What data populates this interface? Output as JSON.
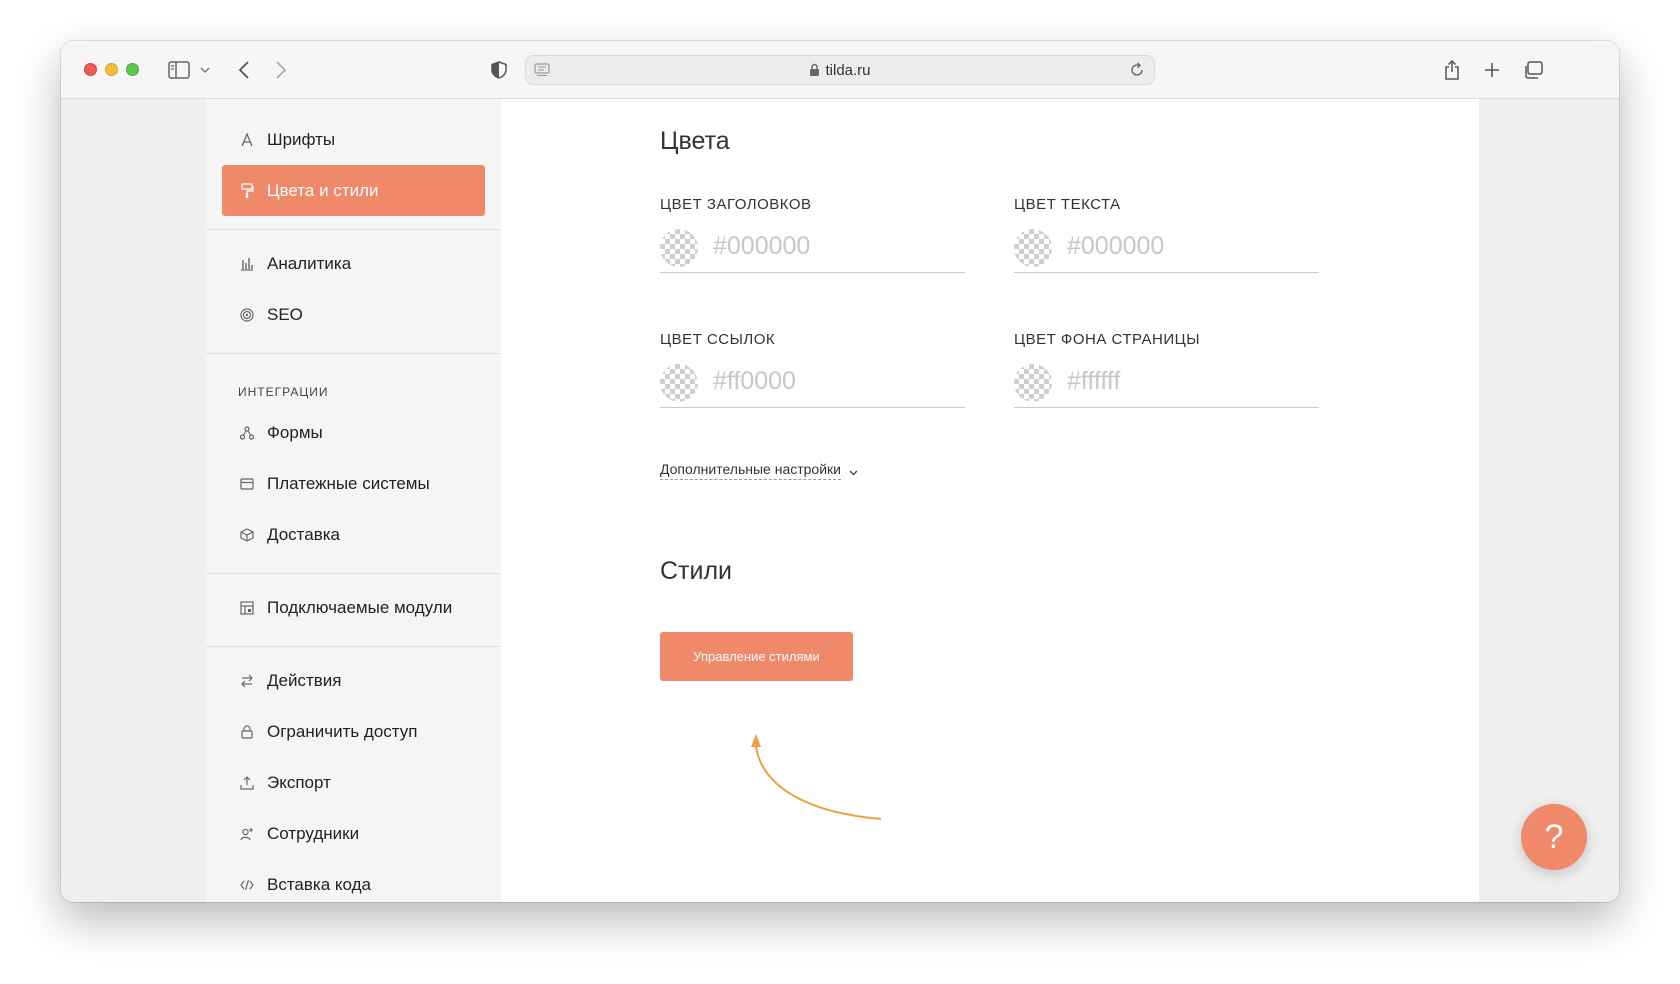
{
  "browser": {
    "url": "tilda.ru"
  },
  "sidebar": {
    "items": [
      {
        "label": "Шрифты",
        "icon": "font-icon"
      },
      {
        "label": "Цвета и стили",
        "icon": "paint-roller-icon",
        "active": true
      },
      {
        "label": "Аналитика",
        "icon": "bar-chart-icon"
      },
      {
        "label": "SEO",
        "icon": "target-icon"
      },
      {
        "label": "Формы",
        "icon": "forms-icon"
      },
      {
        "label": "Платежные системы",
        "icon": "credit-card-icon"
      },
      {
        "label": "Доставка",
        "icon": "box-icon"
      },
      {
        "label": "Подключаемые модули",
        "icon": "modules-icon"
      },
      {
        "label": "Действия",
        "icon": "swap-arrows-icon"
      },
      {
        "label": "Ограничить доступ",
        "icon": "lock-icon"
      },
      {
        "label": "Экспорт",
        "icon": "upload-icon"
      },
      {
        "label": "Сотрудники",
        "icon": "user-plus-icon"
      },
      {
        "label": "Вставка кода",
        "icon": "code-icon"
      }
    ],
    "section_integrations": "ИНТЕГРАЦИИ"
  },
  "main": {
    "colors_title": "Цвета",
    "fields": [
      {
        "label": "ЦВЕТ ЗАГОЛОВКОВ",
        "placeholder": "#000000"
      },
      {
        "label": "ЦВЕТ ТЕКСТА",
        "placeholder": "#000000"
      },
      {
        "label": "ЦВЕТ ССЫЛОК",
        "placeholder": "#ff0000"
      },
      {
        "label": "ЦВЕТ ФОНА СТРАНИЦЫ",
        "placeholder": "#ffffff"
      }
    ],
    "more_settings": "Дополнительные настройки",
    "styles_title": "Стили",
    "styles_button": "Управление стилями"
  },
  "help": {
    "label": "?"
  },
  "theme": {
    "accent": "#f0896a",
    "annotation_arrow": "#f0a040"
  }
}
